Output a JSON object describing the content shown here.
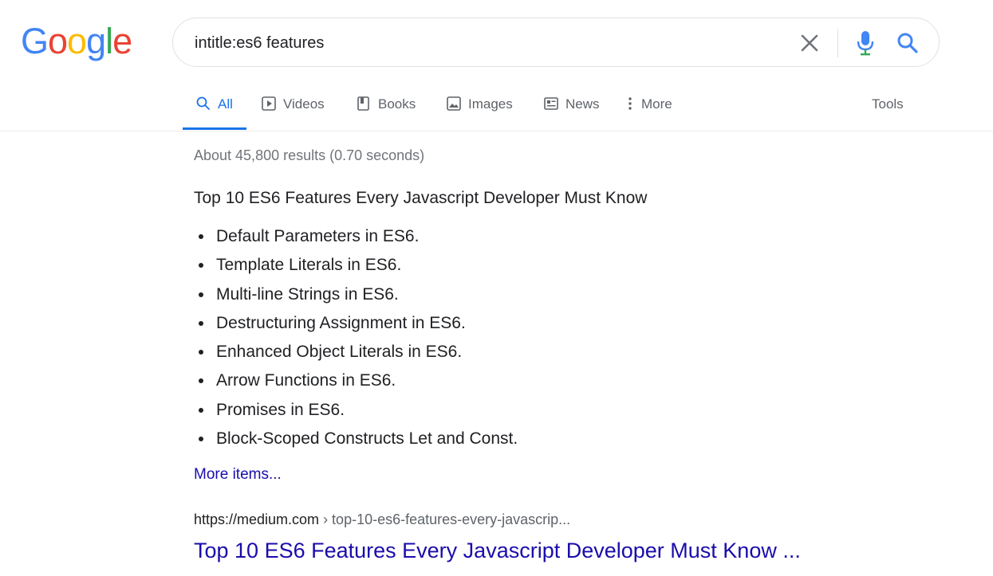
{
  "logo": {
    "letters": [
      "G",
      "o",
      "o",
      "g",
      "l",
      "e"
    ],
    "colors": [
      "#4285f4",
      "#ea4335",
      "#fbbc05",
      "#4285f4",
      "#34a853",
      "#ea4335"
    ]
  },
  "search": {
    "query": "intitle:es6 features",
    "clear_icon": "close-icon",
    "mic_icon": "microphone-icon",
    "search_icon": "search-icon"
  },
  "tabs": [
    {
      "label": "All",
      "icon": "search-icon",
      "active": true
    },
    {
      "label": "Videos",
      "icon": "play-icon",
      "active": false
    },
    {
      "label": "Books",
      "icon": "book-icon",
      "active": false
    },
    {
      "label": "Images",
      "icon": "image-icon",
      "active": false
    },
    {
      "label": "News",
      "icon": "news-icon",
      "active": false
    },
    {
      "label": "More",
      "icon": "more-vert-icon",
      "active": false
    }
  ],
  "tools_label": "Tools",
  "result_stats": "About 45,800 results (0.70 seconds)",
  "featured_snippet": {
    "title": "Top 10 ES6 Features Every Javascript Developer Must Know",
    "items": [
      "Default Parameters in ES6.",
      "Template Literals in ES6.",
      "Multi-line Strings in ES6.",
      "Destructuring Assignment in ES6.",
      "Enhanced Object Literals in ES6.",
      "Arrow Functions in ES6.",
      "Promises in ES6.",
      "Block-Scoped Constructs Let and Const."
    ],
    "more_items_label": "More items..."
  },
  "result": {
    "site": "https://medium.com",
    "breadcrumb": " › top-10-es6-features-every-javascrip...",
    "title": "Top 10 ES6 Features Every Javascript Developer Must Know ..."
  },
  "colors": {
    "accent": "#1a73e8",
    "link": "#1a0dab",
    "muted": "#70757a",
    "icon_gray": "#70757a",
    "mic_blue": "#4285f4"
  }
}
